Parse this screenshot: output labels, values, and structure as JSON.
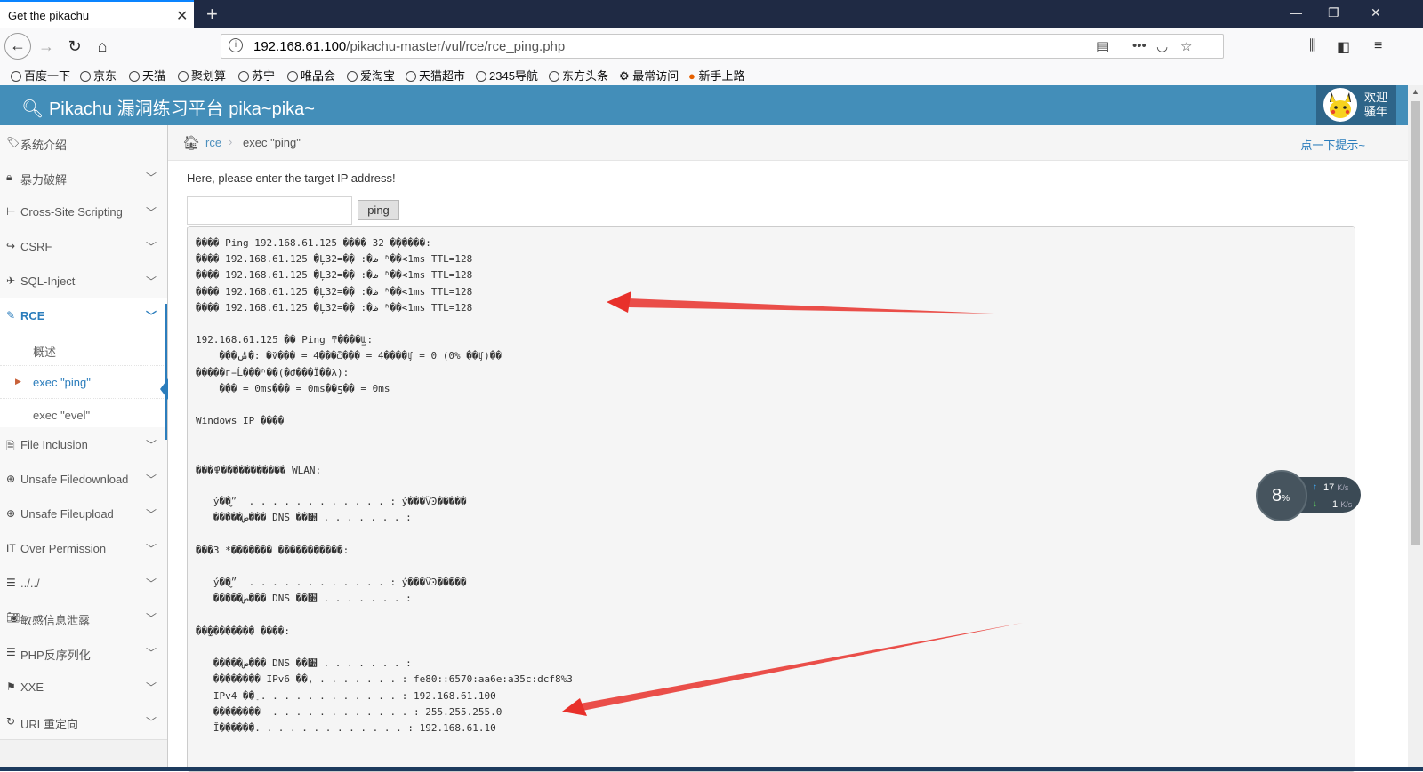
{
  "browser": {
    "tab_title": "Get the pikachu",
    "url_host": "192.168.61.100",
    "url_path": "/pikachu-master/vul/rce/rce_ping.php",
    "bookmarks": [
      "百度一下",
      "京东",
      "天猫",
      "聚划算",
      "苏宁",
      "唯品会",
      "爱淘宝",
      "天猫超市",
      "2345导航",
      "东方头条",
      "最常访问",
      "新手上路"
    ]
  },
  "header": {
    "title": "Pikachu 漏洞练习平台 pika~pika~",
    "welcome_line1": "欢迎",
    "welcome_line2": "骚年"
  },
  "sidebar": {
    "items": [
      {
        "label": "系统介绍",
        "icon": "tags-icon"
      },
      {
        "label": "暴力破解",
        "icon": "lock-icon"
      },
      {
        "label": "Cross-Site Scripting",
        "icon": "sitemap-icon"
      },
      {
        "label": "CSRF",
        "icon": "share-icon"
      },
      {
        "label": "SQL-Inject",
        "icon": "plane-icon"
      },
      {
        "label": "RCE",
        "icon": "pencil-icon"
      },
      {
        "label": "File Inclusion",
        "icon": "file-icon"
      },
      {
        "label": "Unsafe Filedownload",
        "icon": "download-icon"
      },
      {
        "label": "Unsafe Fileupload",
        "icon": "upload-icon"
      },
      {
        "label": "Over Permission",
        "icon": "text-height-icon"
      },
      {
        "label": "../../",
        "icon": "list-icon"
      },
      {
        "label": "敏感信息泄露",
        "icon": "camera-icon"
      },
      {
        "label": "PHP反序列化",
        "icon": "list-icon"
      },
      {
        "label": "XXE",
        "icon": "flag-icon"
      },
      {
        "label": "URL重定向",
        "icon": "refresh-icon"
      }
    ],
    "rce_sub": [
      "概述",
      "exec \"ping\"",
      "exec \"evel\""
    ]
  },
  "breadcrumb": {
    "link": "rce",
    "sep": "›",
    "current": "exec \"ping\"",
    "hint": "点一下提示~"
  },
  "main": {
    "prompt": "Here, please enter the target IP address!",
    "input_value": "",
    "button_label": "ping",
    "output_lines": [
      "���� Ping 192.168.61.125 ���� 32 �ֽ�����:",
      "���� 192.168.61.125 �Ļظ�: �ֽ�=32 ʱ��<1ms TTL=128",
      "���� 192.168.61.125 �Ļظ�: �ֽ�=32 ʱ��<1ms TTL=128",
      "���� 192.168.61.125 �Ļظ�: �ֽ�=32 ʱ��<1ms TTL=128",
      "���� 192.168.61.125 �Ļظ�: �ֽ�=32 ʱ��<1ms TTL=128",
      "",
      "192.168.61.125 �� Ping ͳ����Ϣ:",
      "    ���ݰ�: �ѷ��� = 4���ѽ��� = 4����ʧ = 0 (0% ��ʧ)��",
      "�����г̵Ĺ���ʱ��(�Ժ���Ϊ��λ):",
      "    ��� = 0ms��� = 0ms��ƽ�� = 0ms",
      "",
      "Windows IP ����",
      "",
      "",
      "���߾����������� WLAN:",
      "",
      "   ý��״̬  . . . . . . . . . . . . : ý���ѶϿ�����",
      "   �����ض��� DNS ��׺ . . . . . . . :",
      "",
      "���3 *������� �����������:",
      "",
      "   ý��״̬  . . . . . . . . . . . . : ý���ѶϿ�����",
      "   �����ض��� DNS ��׺ . . . . . . . :",
      "",
      "��̫�������� ����:",
      "",
      "   �����ض��� DNS ��׺ . . . . . . . :",
      "   �������� IPv6 ��ַ. . . . . . . . : fe80::6570:aa6e:a35c:dcf8%3",
      "   IPv4 ��ַ . . . . . . . . . . . . : 192.168.61.100",
      "   ��������  . . . . . . . . . . . . : 255.255.255.0",
      "   Ĭ������. . . . . . . . . . . . . : 192.168.61.10"
    ]
  },
  "net_widget": {
    "percent": "8",
    "percent_unit": "%",
    "upload": "17",
    "download": "1",
    "unit": "K/s"
  },
  "colors": {
    "header": "#438eb9",
    "accent": "#2b7dbc",
    "annotation_arrow": "#e8302a"
  }
}
